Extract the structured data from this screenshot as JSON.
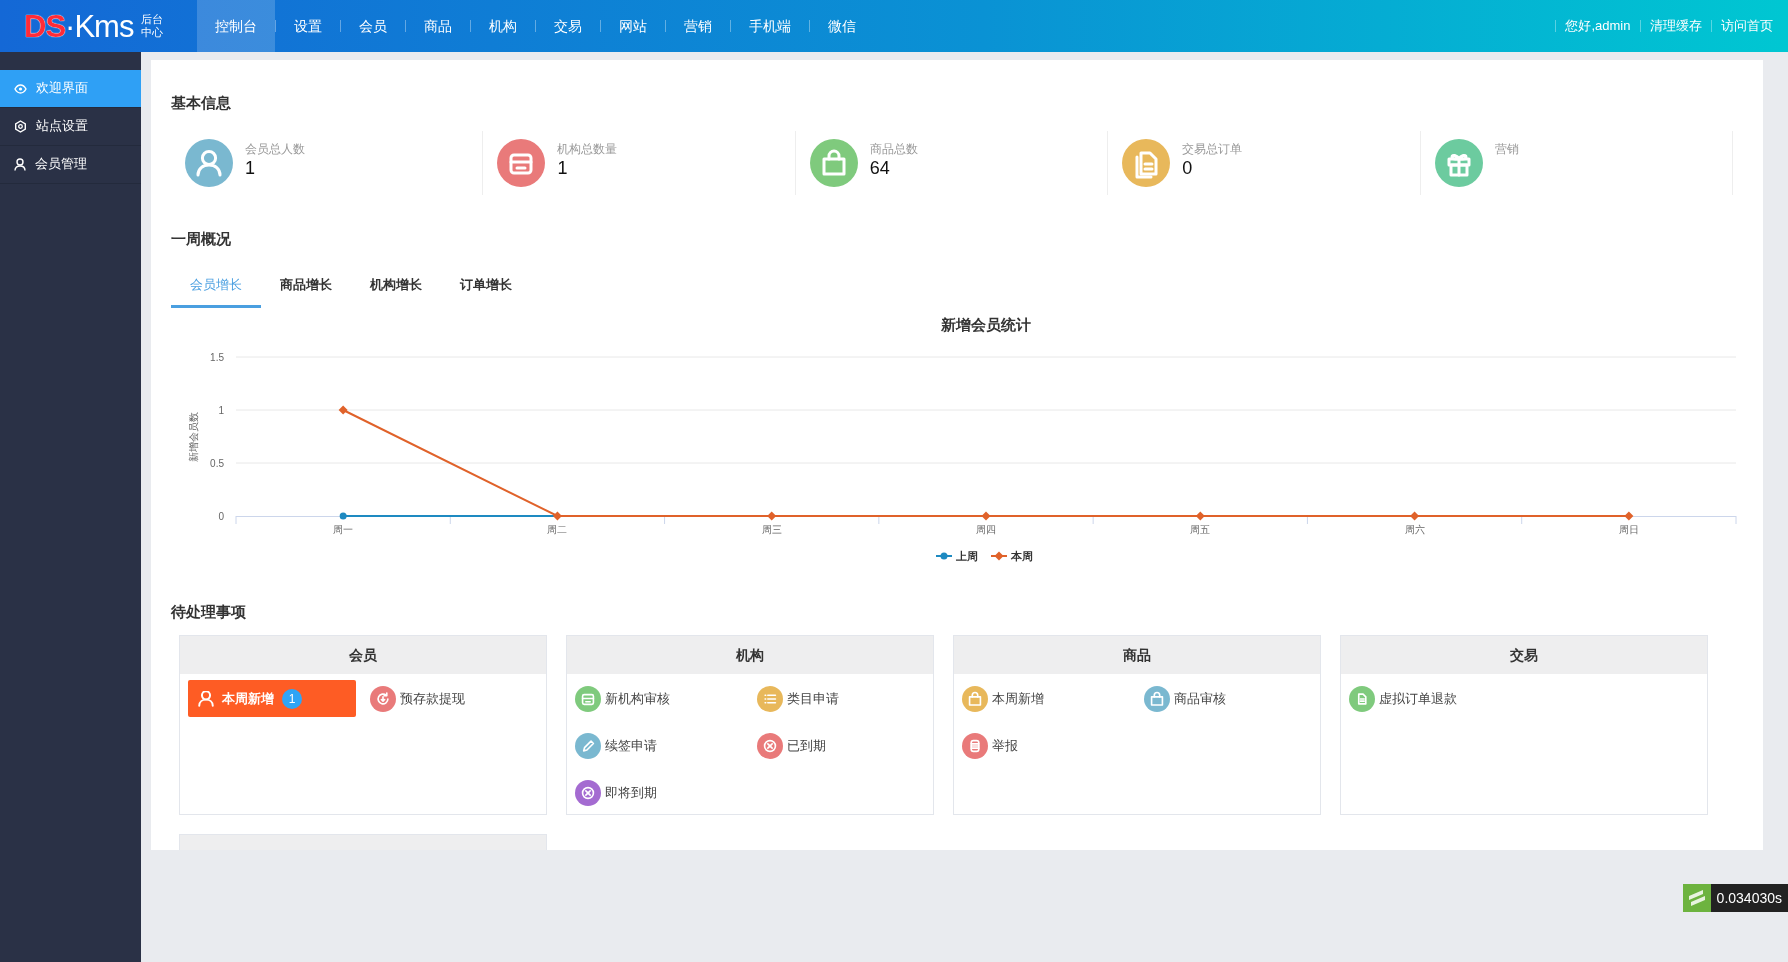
{
  "header": {
    "logo": {
      "brand_red": "DS",
      "brand_white": "·Kms",
      "subtitle_line_1": "后台",
      "subtitle_line_2": "中心"
    },
    "nav": [
      {
        "label": "控制台",
        "selected": true
      },
      {
        "label": "设置",
        "selected": false
      },
      {
        "label": "会员",
        "selected": false
      },
      {
        "label": "商品",
        "selected": false
      },
      {
        "label": "机构",
        "selected": false
      },
      {
        "label": "交易",
        "selected": false
      },
      {
        "label": "网站",
        "selected": false
      },
      {
        "label": "营销",
        "selected": false
      },
      {
        "label": "手机端",
        "selected": false
      },
      {
        "label": "微信",
        "selected": false
      }
    ],
    "user_links": [
      "您好,admin",
      "清理缓存",
      "访问首页"
    ]
  },
  "sidebar": {
    "items": [
      {
        "label": "欢迎界面",
        "selected": true
      },
      {
        "label": "站点设置",
        "selected": false
      },
      {
        "label": "会员管理",
        "selected": false
      }
    ]
  },
  "basic_info": {
    "title": "基本信息",
    "stats": [
      {
        "label": "会员总人数",
        "value": "1",
        "color": "#7ab8d0"
      },
      {
        "label": "机构总数量",
        "value": "1",
        "color": "#e97a7a"
      },
      {
        "label": "商品总数",
        "value": "64",
        "color": "#7fca7d"
      },
      {
        "label": "交易总订单",
        "value": "0",
        "color": "#e8b85b"
      },
      {
        "label": "营销",
        "color": "#6ccb9f"
      }
    ]
  },
  "weekly": {
    "title": "一周概况",
    "tabs": [
      {
        "label": "会员增长",
        "selected": true
      },
      {
        "label": "商品增长",
        "selected": false
      },
      {
        "label": "机构增长",
        "selected": false
      },
      {
        "label": "订单增长",
        "selected": false
      }
    ],
    "chart_data": {
      "type": "line",
      "title": "新增会员统计",
      "ylabel": "新增会员数",
      "categories": [
        "周一",
        "周二",
        "周三",
        "周四",
        "周五",
        "周六",
        "周日"
      ],
      "ylim": [
        0,
        1.5
      ],
      "yticks": [
        0,
        0.5,
        1,
        1.5
      ],
      "legend": "bottom",
      "series": [
        {
          "name": "上周",
          "color": "#1e8ac1",
          "marker": "circle",
          "values": [
            0,
            0,
            null,
            null,
            null,
            null,
            null
          ]
        },
        {
          "name": "本周",
          "color": "#e0622a",
          "marker": "diamond",
          "values": [
            1,
            0,
            0,
            0,
            0,
            0,
            0
          ]
        }
      ]
    }
  },
  "pending": {
    "title": "待处理事项",
    "groups": [
      {
        "title": "会员",
        "items": [
          {
            "kind": "highlight",
            "label": "本周新增",
            "badge": "1"
          },
          {
            "kind": "plain",
            "label": "预存款提现",
            "color": "#e97a7a"
          }
        ]
      },
      {
        "title": "机构",
        "items": [
          {
            "kind": "plain",
            "label": "新机构审核",
            "color": "#7fca7d"
          },
          {
            "kind": "plain",
            "label": "类目申请",
            "color": "#e8b85b"
          },
          {
            "kind": "plain",
            "label": "续签申请",
            "color": "#7ab8d0"
          },
          {
            "kind": "plain",
            "label": "已到期",
            "color": "#e97a7a"
          },
          {
            "kind": "plain",
            "label": "即将到期",
            "color": "#a46bd1"
          }
        ]
      },
      {
        "title": "商品",
        "items": [
          {
            "kind": "plain",
            "label": "本周新增",
            "color": "#e8b85b"
          },
          {
            "kind": "plain",
            "label": "商品审核",
            "color": "#7ab8d0"
          },
          {
            "kind": "plain",
            "label": "举报",
            "color": "#e97a7a"
          }
        ]
      },
      {
        "title": "交易",
        "items": [
          {
            "kind": "plain",
            "label": "虚拟订单退款",
            "color": "#7fca7d"
          }
        ]
      }
    ]
  },
  "timer": {
    "text": "0.034030s"
  }
}
